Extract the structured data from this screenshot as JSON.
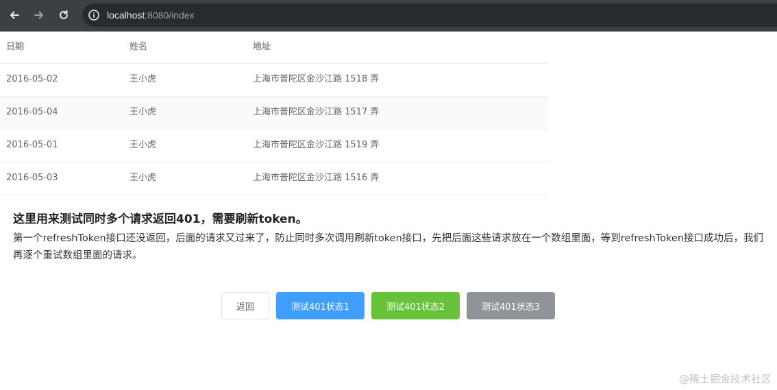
{
  "browser": {
    "url_host": "localhost",
    "url_rest": ":8080/index"
  },
  "table": {
    "headers": [
      "日期",
      "姓名",
      "地址"
    ],
    "rows": [
      [
        "2016-05-02",
        "王小虎",
        "上海市普陀区金沙江路 1518 弄"
      ],
      [
        "2016-05-04",
        "王小虎",
        "上海市普陀区金沙江路 1517 弄"
      ],
      [
        "2016-05-01",
        "王小虎",
        "上海市普陀区金沙江路 1519 弄"
      ],
      [
        "2016-05-03",
        "王小虎",
        "上海市普陀区金沙江路 1516 弄"
      ]
    ]
  },
  "content": {
    "heading": "这里用来测试同时多个请求返回401，需要刷新token。",
    "description": "第一个refreshToken接口还没返回，后面的请求又过来了，防止同时多次调用刷新token接口，先把后面这些请求放在一个数组里面，等到refreshToken接口成功后，我们再逐个重试数组里面的请求。"
  },
  "buttons": {
    "back": "返回",
    "test1": "测试401状态1",
    "test2": "测试401状态2",
    "test3": "测试401状态3"
  },
  "watermark": "@稀土掘金技术社区",
  "colors": {
    "primary": "#409eff",
    "success": "#67c23a",
    "info": "#909399"
  },
  "icons": [
    "back-arrow-icon",
    "forward-arrow-icon",
    "reload-icon",
    "info-icon"
  ]
}
